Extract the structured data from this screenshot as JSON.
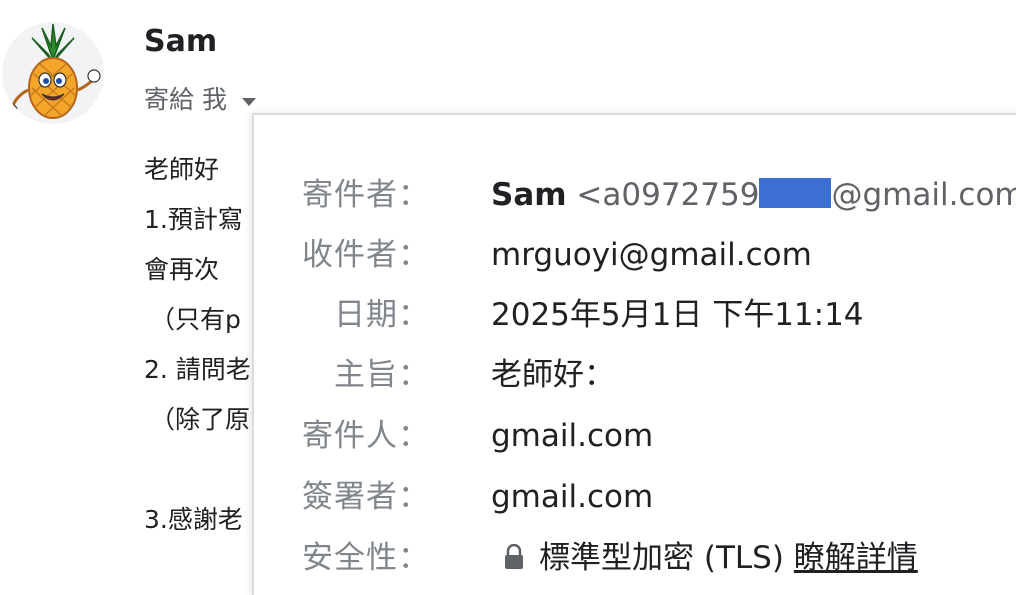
{
  "sender": {
    "name": "Sam"
  },
  "recipient_summary": {
    "label": "寄給 我"
  },
  "body_lines": [
    "老師好",
    "1.預計寫",
    "會再次",
    "（只有p",
    "2. 請問老",
    "（除了原",
    "",
    "3.感謝老"
  ],
  "details": {
    "from": {
      "label": "寄件者：",
      "name": "Sam",
      "email_prefix": "<a0972759",
      "email_suffix": "@gmail.com>"
    },
    "to": {
      "label": "收件者：",
      "value": "mrguoyi@gmail.com"
    },
    "date": {
      "label": "日期：",
      "value": "2025年5月1日 下午11:14"
    },
    "subject": {
      "label": "主旨：",
      "value": "老師好："
    },
    "mailed_by": {
      "label": "寄件人：",
      "value": "gmail.com"
    },
    "signed_by": {
      "label": "簽署者：",
      "value": "gmail.com"
    },
    "security": {
      "label": "安全性：",
      "value": "標準型加密 (TLS)",
      "link": "瞭解詳情"
    }
  },
  "icons": {
    "caret": "caret-down-icon",
    "lock": "lock-icon",
    "avatar": "pineapple-mascot"
  },
  "colors": {
    "label_gray": "#80868b",
    "secondary": "#5f6368",
    "text": "#202124",
    "redaction": "#3c6fd6"
  }
}
